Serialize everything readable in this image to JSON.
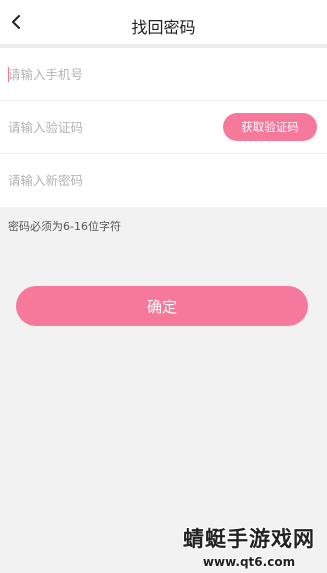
{
  "header": {
    "title": "找回密码",
    "back_icon": "chevron-left-icon"
  },
  "form": {
    "phone": {
      "placeholder": "请输入手机号",
      "value": ""
    },
    "code": {
      "placeholder": "请输入验证码",
      "value": "",
      "button_label": "获取验证码"
    },
    "new_password": {
      "placeholder": "请输入新密码",
      "value": ""
    }
  },
  "hint": "密码必须为6-16位字符",
  "confirm_label": "确定",
  "watermark": {
    "title": "蜻蜓手游戏网",
    "url": "www.qt6.com"
  },
  "colors": {
    "accent": "#f6789a",
    "background": "#f2f2f2"
  }
}
